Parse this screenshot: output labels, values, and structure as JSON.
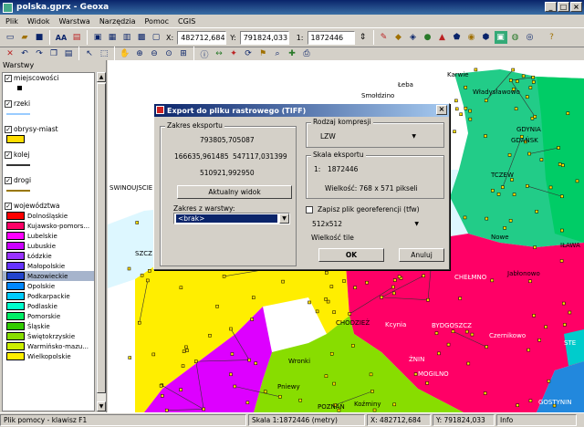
{
  "window": {
    "title": "polska.gprx - Geoxa",
    "controls": [
      "_",
      "□",
      "×"
    ]
  },
  "menu": [
    "Plik",
    "Widok",
    "Warstwa",
    "Narzędzia",
    "Pomoc",
    "CGIS"
  ],
  "toolbar": {
    "x_label": "X:",
    "x_value": "482712,684",
    "y_label": "Y:",
    "y_value": "791824,033",
    "scale_label": "1:",
    "scale_value": "1872446",
    "aa_label": "AA"
  },
  "sidebar": {
    "title": "Warstwy",
    "layers": [
      {
        "name": "miejscowości",
        "checked": true,
        "legend": "dot"
      },
      {
        "name": "rzeki",
        "checked": true,
        "legend": "line-light"
      },
      {
        "name": "obrysy-miast",
        "checked": true,
        "legend": "box-yellow"
      },
      {
        "name": "kolej",
        "checked": true,
        "legend": "line-dark"
      },
      {
        "name": "drogi",
        "checked": true,
        "legend": "line-olive"
      },
      {
        "name": "województwa",
        "checked": true,
        "legend": "none"
      }
    ],
    "regions": [
      {
        "name": "Dolnośląskie",
        "color": "#ff0000"
      },
      {
        "name": "Kujawsko-pomors...",
        "color": "#ff0066"
      },
      {
        "name": "Lubelskie",
        "color": "#ff00ff"
      },
      {
        "name": "Lubuskie",
        "color": "#cc00ff"
      },
      {
        "name": "Łódzkie",
        "color": "#9933ff"
      },
      {
        "name": "Małopolskie",
        "color": "#6633ff"
      },
      {
        "name": "Mazowieckie",
        "color": "#2244cc",
        "selected": true
      },
      {
        "name": "Opolskie",
        "color": "#0088ff"
      },
      {
        "name": "Podkarpackie",
        "color": "#00ccff"
      },
      {
        "name": "Podlaskie",
        "color": "#00ffcc"
      },
      {
        "name": "Pomorskie",
        "color": "#00ee66"
      },
      {
        "name": "Śląskie",
        "color": "#33cc00"
      },
      {
        "name": "Świętokrzyskie",
        "color": "#88dd00"
      },
      {
        "name": "Warmińsko-mazu...",
        "color": "#ccee00"
      },
      {
        "name": "Wielkopolskie",
        "color": "#ffee00"
      }
    ]
  },
  "map": {
    "labels": [
      "Łeba",
      "Karwie",
      "Władysławowo",
      "Smołdzino",
      "GDYNIA",
      "GDAŃSK",
      "TCZEW",
      "SWINOUJSCIE",
      "SZCZ",
      "Nowe",
      "IŁAWA",
      "CHEŁMNO",
      "Jabłonowo",
      "BYDGOSZCZ",
      "Kcynia",
      "CHODZIEŻ",
      "ŻNIN",
      "Czernikowo",
      "MOGILNO",
      "Wronki",
      "Pniewy",
      "POZNAŃ",
      "Koźminy",
      "GOSTYNIN",
      "STE"
    ]
  },
  "status": {
    "help": "Plik pomocy - klawisz F1",
    "scale": "Skala 1:1872446 (metry)",
    "x": "X: 482712,684",
    "y": "Y: 791824,033",
    "info": "Info"
  },
  "dialog": {
    "title": "Export do pliku rastrowego (TIFF)",
    "extent_group": "Zakres eksportu",
    "extent_top": "793805,705087",
    "extent_left": "166635,961485",
    "extent_right": "547117,031399",
    "extent_bottom": "510921,992950",
    "current_view_btn": "Aktualny widok",
    "layer_extent_label": "Zakres z warstwy:",
    "layer_extent_value": "<brak>",
    "compression_group": "Rodzaj kompresji",
    "compression_value": "LZW",
    "scale_group": "Skala eksportu",
    "scale_prefix": "1:",
    "scale_value": "1872446",
    "size_text": "Wielkość: 768 x 571 pikseli",
    "georef_label": "Zapisz plik georeferencji (tfw)",
    "tile_value": "512x512",
    "tile_label": "Wielkość tile",
    "ok": "OK",
    "cancel": "Anuluj"
  }
}
